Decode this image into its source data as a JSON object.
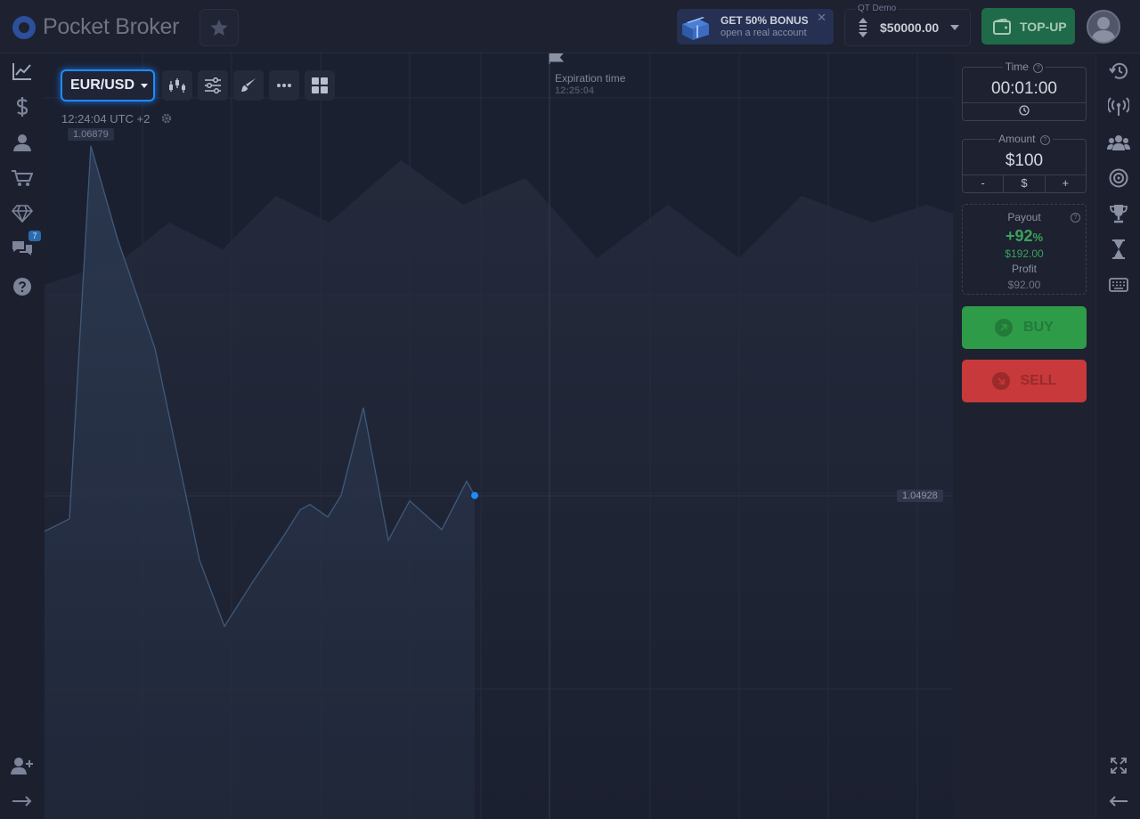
{
  "app": {
    "brand": "Pocket Broker"
  },
  "bonus": {
    "title": "GET 50% BONUS",
    "subtitle": "open a real account",
    "close_glyph": "✕"
  },
  "account": {
    "label": "QT Demo",
    "balance": "$50000.00"
  },
  "topup": {
    "label": "TOP-UP"
  },
  "left_nav": {
    "items": [
      {
        "icon": "chart-icon"
      },
      {
        "icon": "dollar-icon"
      },
      {
        "icon": "user-icon"
      },
      {
        "icon": "cart-icon"
      },
      {
        "icon": "diamond-icon"
      },
      {
        "icon": "chat-icon",
        "badge": "7"
      },
      {
        "icon": "help-icon"
      },
      {
        "icon": "add-user-icon"
      },
      {
        "icon": "logout-icon"
      }
    ]
  },
  "chart": {
    "asset": "EUR/USD",
    "server_time": "12:24:04 UTC +2",
    "high_price": "1.06879",
    "current_price": "1.04928",
    "expiration_label": "Expiration time",
    "expiration_time": "12:25:04",
    "accent_color": "#1d8bff",
    "line_color": "#3f5a7a",
    "price_points": [
      1.0473,
      1.048,
      1.0688,
      1.0636,
      1.0575,
      1.0457,
      1.042,
      1.0445,
      1.047,
      1.0485,
      1.0488,
      1.0481,
      1.0493,
      1.0542,
      1.0468,
      1.049,
      1.0474,
      1.0501,
      1.0493
    ]
  },
  "trade": {
    "time_label": "Time",
    "time_value": "00:01:00",
    "amount_label": "Amount",
    "amount_value": "$100",
    "amount_minus": "-",
    "amount_currency": "$",
    "amount_plus": "+",
    "payout_label": "Payout",
    "payout_percent": "+92",
    "payout_percent_unit": "%",
    "payout_amount": "$192.00",
    "profit_label": "Profit",
    "profit_amount": "$92.00",
    "buy_label": "BUY",
    "sell_label": "SELL",
    "buy_color": "#2e9b48",
    "sell_color": "#c7393a"
  },
  "right_nav": {
    "items": [
      {
        "icon": "history-icon"
      },
      {
        "icon": "signal-icon"
      },
      {
        "icon": "social-icon"
      },
      {
        "icon": "target-icon"
      },
      {
        "icon": "trophy-icon"
      },
      {
        "icon": "hourglass-icon"
      },
      {
        "icon": "keyboard-icon"
      },
      {
        "icon": "fullscreen-icon"
      },
      {
        "icon": "collapse-arrow-icon"
      }
    ]
  }
}
